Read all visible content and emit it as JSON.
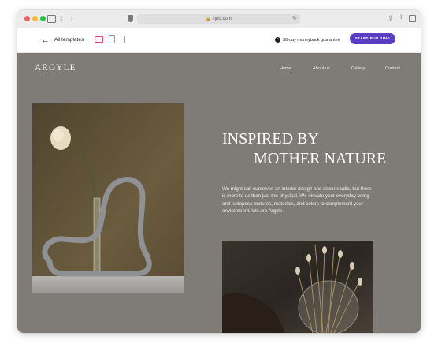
{
  "browser": {
    "url": "zyro.com"
  },
  "toolbar": {
    "back_label": "All templates",
    "guarantee": "30-day moneyback guarantee",
    "start_button": "START BUILDING"
  },
  "site": {
    "logo": "ARGYLE",
    "nav": [
      "Home",
      "About us",
      "Gallery",
      "Contact"
    ],
    "heading_line1": "INSPIRED BY",
    "heading_line2": "MOTHER NATURE",
    "intro": "We might call ourselves an interior design and decor studio, but there is more to us than just the physical. We elevate your everyday being and juxtapose textures, materials, and colors to complement your environment. We are Argyle."
  },
  "colors": {
    "site_background": "#7f7b76",
    "button": "#5b3cc4",
    "device_active": "#e0417a"
  },
  "icons": [
    "sidebar-icon",
    "back-icon",
    "forward-icon",
    "shield-icon",
    "lock-icon",
    "reload-icon",
    "share-icon",
    "plus-icon",
    "tabs-icon",
    "arrow-left-icon",
    "desktop-icon",
    "tablet-icon",
    "mobile-icon",
    "check-circle-icon"
  ]
}
